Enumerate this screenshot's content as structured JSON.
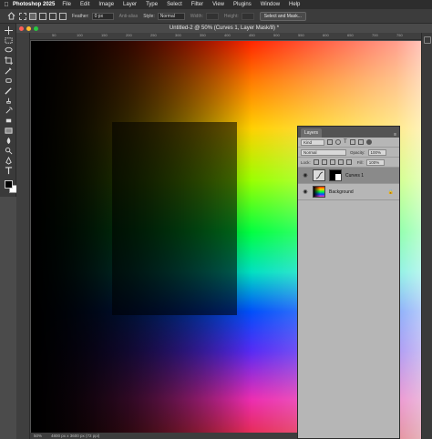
{
  "menubar": {
    "app": "Photoshop 2025",
    "items": [
      "File",
      "Edit",
      "Image",
      "Layer",
      "Type",
      "Select",
      "Filter",
      "View",
      "Plugins",
      "Window",
      "Help"
    ]
  },
  "options": {
    "feather_label": "Feather:",
    "feather_value": "0 px",
    "antialias_label": "Anti-alias",
    "style_label": "Style:",
    "style_value": "Normal",
    "width_label": "Width:",
    "height_label": "Height:",
    "select_mask_label": "Select and Mask..."
  },
  "document": {
    "title": "Untitled-2 @ 50% (Curves 1, Layer Mask/8) *"
  },
  "rulers": {
    "top_ticks": [
      "50",
      "100",
      "150",
      "200",
      "250",
      "300",
      "350",
      "400",
      "450",
      "500",
      "550",
      "600",
      "650",
      "700",
      "750",
      "800"
    ]
  },
  "status": {
    "zoom": "50%",
    "info": "4800 px x 3600 px (72 ppi)"
  },
  "layers_panel": {
    "tab_label": "Layers",
    "kind_label": "Kind",
    "blend_mode": "Normal",
    "opacity_label": "Opacity:",
    "opacity_value": "100%",
    "lock_label": "Lock:",
    "fill_label": "Fill:",
    "fill_value": "100%",
    "layers": [
      {
        "name": "Curves 1",
        "selected": true,
        "visible": true
      },
      {
        "name": "Background",
        "selected": false,
        "visible": true,
        "locked": true
      }
    ]
  },
  "colors": {
    "foreground": "#000000",
    "background": "#ffffff",
    "panel": "#b6b6b6"
  }
}
